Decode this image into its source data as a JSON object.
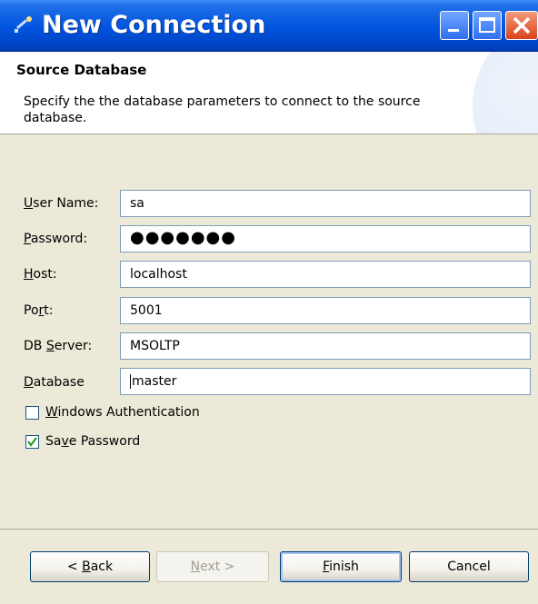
{
  "window": {
    "title": "New Connection",
    "icon": "wizard-icon",
    "controls": [
      "minimize-icon",
      "maximize-icon",
      "close-icon"
    ]
  },
  "banner": {
    "title": "Source Database",
    "description": "Specify the the database parameters to connect to the source database."
  },
  "form": {
    "user_name": {
      "label_prefix": "",
      "label_accel": "U",
      "label_rest": "ser Name:",
      "value": "sa"
    },
    "password": {
      "label_prefix": "",
      "label_accel": "P",
      "label_rest": "assword:",
      "value": "●●●●●●●"
    },
    "host": {
      "label_prefix": "",
      "label_accel": "H",
      "label_rest": "ost:",
      "value": "localhost"
    },
    "port": {
      "label_prefix": "Po",
      "label_accel": "r",
      "label_rest": "t:",
      "value": "5001"
    },
    "db_server": {
      "label_prefix": "DB ",
      "label_accel": "S",
      "label_rest": "erver:",
      "value": "MSOLTP"
    },
    "database": {
      "label_prefix": "",
      "label_accel": "D",
      "label_rest": "atabase",
      "value": "master"
    },
    "windows_auth": {
      "label_prefix": "",
      "label_accel": "W",
      "label_rest": "indows Authentication",
      "checked": false
    },
    "save_password": {
      "label_prefix": "Sa",
      "label_accel": "v",
      "label_rest": "e Password",
      "checked": true,
      "check_mark": "✔"
    }
  },
  "buttons": {
    "back": {
      "prefix": "< ",
      "accel": "B",
      "rest": "ack"
    },
    "next": {
      "prefix": "",
      "accel": "N",
      "rest": "ext >"
    },
    "finish": {
      "prefix": "",
      "accel": "F",
      "rest": "inish"
    },
    "cancel": {
      "label": "Cancel"
    }
  },
  "colors": {
    "titlebar": "#0053de",
    "dialog_bg": "#ece9d8",
    "field_border": "#7f9db9",
    "check_mark": "#21a121"
  }
}
